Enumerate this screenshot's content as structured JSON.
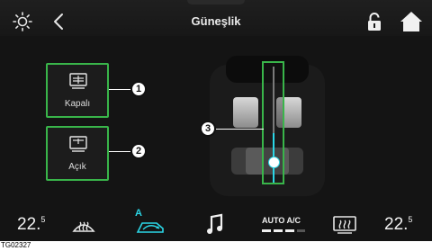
{
  "header": {
    "title": "Güneşlik"
  },
  "panel": {
    "closed_label": "Kapalı",
    "open_label": "Açık",
    "callouts": [
      "1",
      "2",
      "3"
    ]
  },
  "bottom": {
    "temp_left_main": "22.",
    "temp_left_dec": "5",
    "temp_right_main": "22.",
    "temp_right_dec": "5",
    "auto_ac": "AUTO A/C",
    "air_badge": "A"
  },
  "figure_id": "TG02327",
  "colors": {
    "accent_green": "#39b54a",
    "slider_cyan": "#2bd6e6"
  },
  "icons": [
    "brightness-icon",
    "back-icon",
    "lock-icon",
    "home-icon",
    "sunshade-closed-icon",
    "sunshade-open-icon",
    "front-defrost-icon",
    "air-recirculation-icon",
    "music-icon",
    "rear-defrost-icon"
  ]
}
